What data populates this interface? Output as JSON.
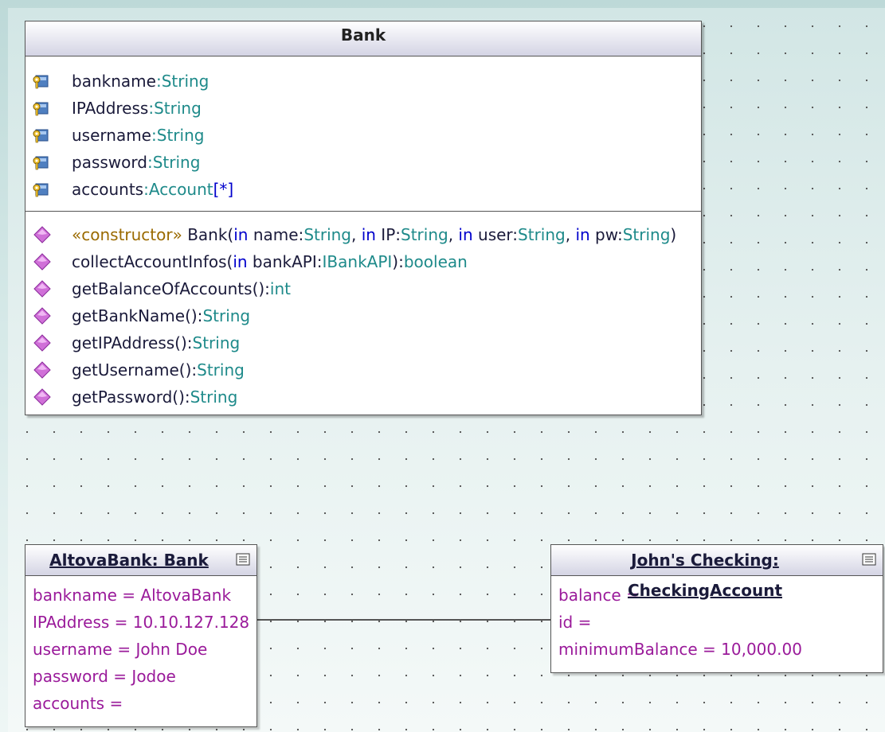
{
  "class_bank": {
    "name": "Bank",
    "attributes": [
      {
        "name": "bankname",
        "sep": ":",
        "type": "String",
        "mult": ""
      },
      {
        "name": "IPAddress",
        "sep": ":",
        "type": "String",
        "mult": ""
      },
      {
        "name": "username",
        "sep": ":",
        "type": "String",
        "mult": ""
      },
      {
        "name": "password",
        "sep": ":",
        "type": "String",
        "mult": ""
      },
      {
        "name": "accounts",
        "sep": ":",
        "type": "Account",
        "mult": "[*]"
      }
    ],
    "constructor": {
      "stereotype": "«constructor»",
      "name": " Bank(",
      "kw1": "in",
      "p1": " name:",
      "t1": "String",
      "kw2": "in",
      "p2": " IP:",
      "t2": "String",
      "kw3": "in",
      "p3": " user:",
      "t3": "String",
      "kw4": "in",
      "p4": " pw:",
      "t4": "String",
      "close": ")"
    },
    "collect_op": {
      "name": "collectAccountInfos(",
      "kw": "in",
      "param": " bankAPI:",
      "ptype": "IBankAPI",
      "close": "):",
      "ret": "boolean"
    },
    "operations": [
      {
        "name": "getBalanceOfAccounts():",
        "ret": "int"
      },
      {
        "name": "getBankName():",
        "ret": "String"
      },
      {
        "name": "getIPAddress():",
        "ret": "String"
      },
      {
        "name": "getUsername():",
        "ret": "String"
      },
      {
        "name": "getPassword():",
        "ret": "String"
      }
    ]
  },
  "object_altovabank": {
    "title": "AltovaBank: Bank",
    "slots": [
      "bankname =  AltovaBank",
      "IPAddress =  10.10.127.128",
      "username =  John Doe",
      "password =  Jodoe",
      "accounts ="
    ]
  },
  "object_checking": {
    "title": "John's Checking: CheckingAccount",
    "slots": [
      "balance =",
      "id =",
      "minimumBalance =  10,000.00"
    ]
  },
  "icons": {
    "attribute": "private-attribute-key-icon",
    "operation": "public-operation-diamond-icon",
    "collapse": "collapse-compartment-icon"
  },
  "colors": {
    "name_text": "#1a1a3a",
    "type_text": "#1e8a8a",
    "keyword_text": "#0000cc",
    "stereotype_text": "#9a6a00",
    "slot_text": "#9a1a9a",
    "operation_icon": "#d070d8"
  }
}
